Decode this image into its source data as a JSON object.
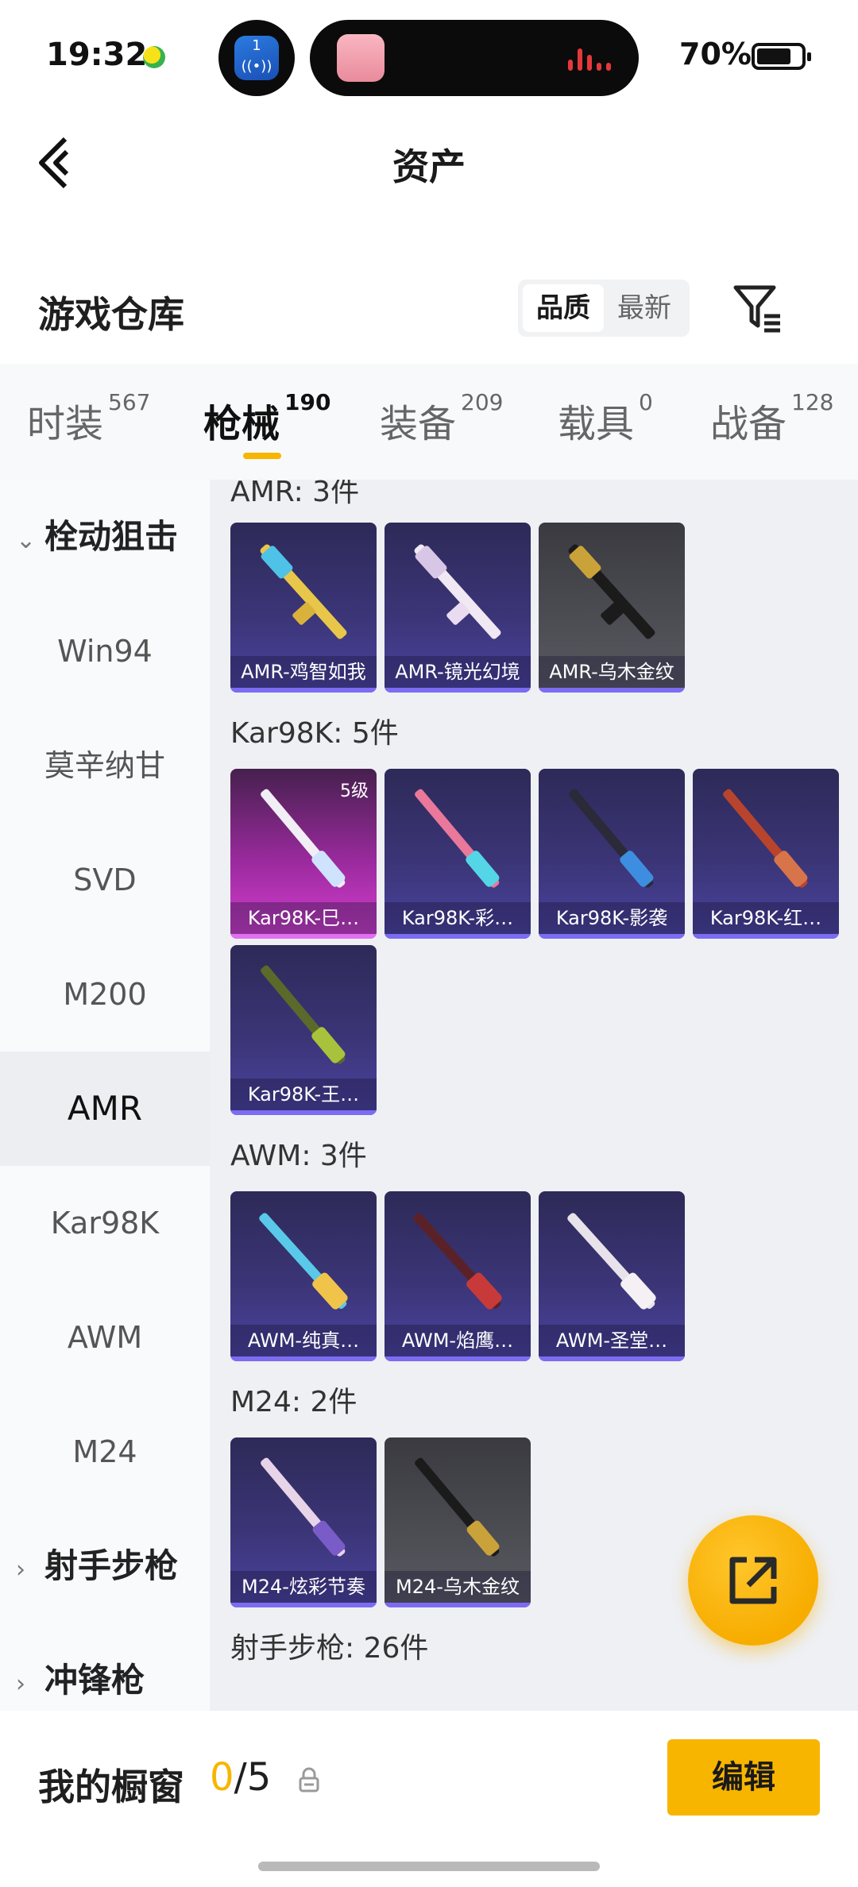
{
  "status_bar": {
    "time": "19:32",
    "battery": "70%",
    "island_app_num": "1"
  },
  "header": {
    "title": "资产"
  },
  "warehouse": {
    "title": "游戏仓库",
    "sort_options": [
      "品质",
      "最新"
    ],
    "selected_sort": "品质"
  },
  "tabs": [
    {
      "label": "时装",
      "count": "567"
    },
    {
      "label": "枪械",
      "count": "190",
      "active": true
    },
    {
      "label": "装备",
      "count": "209"
    },
    {
      "label": "载具",
      "count": "0"
    },
    {
      "label": "战备",
      "count": "128"
    }
  ],
  "sidebar": {
    "group_sniper": "栓动狙击",
    "items": [
      "Win94",
      "莫辛纳甘",
      "SVD",
      "M200",
      "AMR",
      "Kar98K",
      "AWM",
      "M24"
    ],
    "selected": "AMR",
    "group_marksman": "射手步枪",
    "group_smg": "冲锋枪"
  },
  "sections": {
    "amr": {
      "title": "AMR: 3件",
      "cards": [
        "AMR-鸡智如我",
        "AMR-镜光幻境",
        "AMR-乌木金纹"
      ]
    },
    "kar98k": {
      "title": "Kar98K: 5件",
      "level_badge": "5级",
      "cards": [
        "Kar98K-巳…",
        "Kar98K-彩…",
        "Kar98K-影袭",
        "Kar98K-红…",
        "Kar98K-王…"
      ]
    },
    "awm": {
      "title": "AWM: 3件",
      "cards": [
        "AWM-纯真…",
        "AWM-焰鹰…",
        "AWM-圣堂…"
      ]
    },
    "m24": {
      "title": "M24: 2件",
      "cards": [
        "M24-炫彩节奏",
        "M24-乌木金纹"
      ]
    },
    "marksman": {
      "title": "射手步枪: 26件"
    }
  },
  "bottom": {
    "title": "我的橱窗",
    "current": "0",
    "total": "/5",
    "edit_label": "编辑"
  },
  "colors": {
    "accent": "#f7b500",
    "card_bg": "#3b3577",
    "rarity_bar": "#7b6cf2"
  },
  "icons": [
    "back-arrow-icon",
    "filter-icon",
    "lock-icon",
    "share-export-icon",
    "chevron-down-icon",
    "chevron-right-icon",
    "rifle-icon"
  ]
}
